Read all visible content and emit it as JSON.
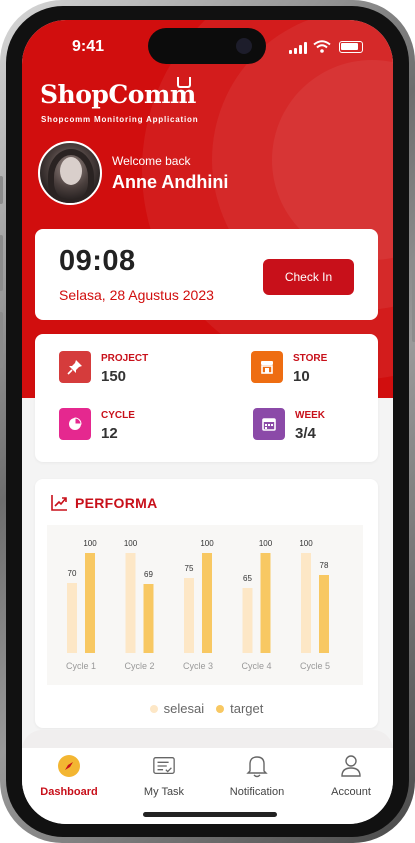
{
  "status_bar": {
    "time": "9:41"
  },
  "brand": {
    "name": "ShopComm",
    "tagline": "Shopcomm Monitoring Application"
  },
  "user": {
    "greeting": "Welcome back",
    "name": "Anne Andhini"
  },
  "checkin": {
    "time": "09:08",
    "date": "Selasa, 28 Agustus 2023",
    "button_label": "Check In"
  },
  "stats": [
    {
      "label": "PROJECT",
      "value": "150",
      "icon": "pin-icon",
      "color": "#d53c3c"
    },
    {
      "label": "STORE",
      "value": "10",
      "icon": "store-icon",
      "color": "#ee6d12"
    },
    {
      "label": "CYCLE",
      "value": "12",
      "icon": "pie-chart-icon",
      "color": "#e5288f"
    },
    {
      "label": "WEEK",
      "value": "3/4",
      "icon": "calendar-icon",
      "color": "#8b4aa8"
    }
  ],
  "performa": {
    "title": "PERFORMA",
    "icon": "trend-up-icon",
    "legend": [
      "selesai",
      "target"
    ]
  },
  "chart_data": {
    "type": "bar",
    "categories": [
      "Cycle 1",
      "Cycle 2",
      "Cycle 3",
      "Cycle 4",
      "Cycle 5"
    ],
    "series": [
      {
        "name": "selesai",
        "values": [
          70,
          100,
          75,
          65,
          100
        ],
        "color": "#fde7c6"
      },
      {
        "name": "target",
        "values": [
          100,
          69,
          100,
          100,
          78
        ],
        "color": "#f8c862"
      }
    ],
    "ylim": [
      0,
      100
    ],
    "grid": false,
    "legend_position": "bottom"
  },
  "nav": [
    {
      "label": "Dashboard",
      "icon": "compass-icon",
      "active": true
    },
    {
      "label": "My Task",
      "icon": "task-icon",
      "active": false
    },
    {
      "label": "Notification",
      "icon": "bell-icon",
      "active": false
    },
    {
      "label": "Account",
      "icon": "user-icon",
      "active": false
    }
  ],
  "colors": {
    "primary": "#d10e0e",
    "accent": "#c8101a"
  }
}
